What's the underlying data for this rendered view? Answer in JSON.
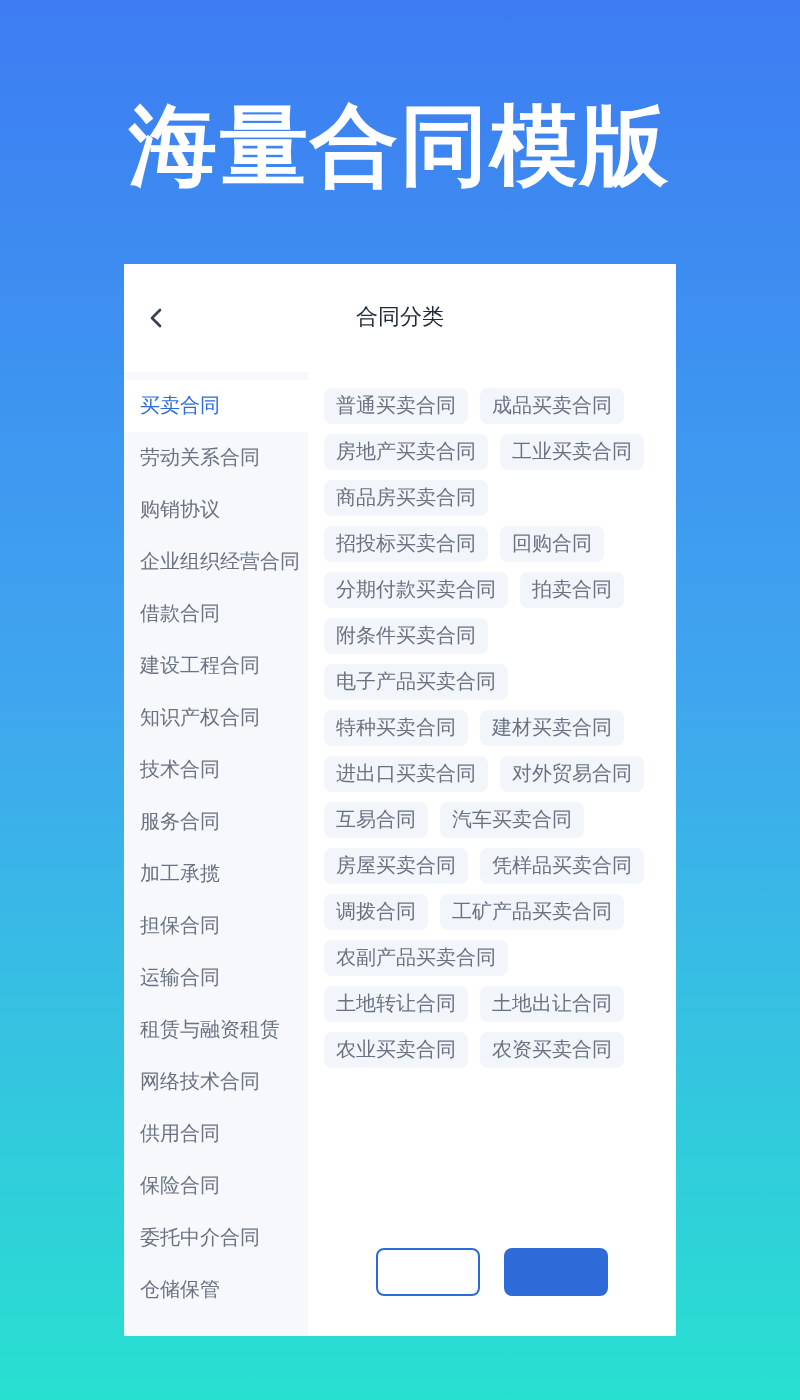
{
  "headline": "海量合同模版",
  "header": {
    "title": "合同分类"
  },
  "sidebar": {
    "items": [
      {
        "label": "买卖合同",
        "selected": true
      },
      {
        "label": "劳动关系合同",
        "selected": false
      },
      {
        "label": "购销协议",
        "selected": false
      },
      {
        "label": "企业组织经营合同",
        "selected": false
      },
      {
        "label": "借款合同",
        "selected": false
      },
      {
        "label": "建设工程合同",
        "selected": false
      },
      {
        "label": "知识产权合同",
        "selected": false
      },
      {
        "label": "技术合同",
        "selected": false
      },
      {
        "label": "服务合同",
        "selected": false
      },
      {
        "label": "加工承揽",
        "selected": false
      },
      {
        "label": "担保合同",
        "selected": false
      },
      {
        "label": "运输合同",
        "selected": false
      },
      {
        "label": "租赁与融资租赁",
        "selected": false
      },
      {
        "label": "网络技术合同",
        "selected": false
      },
      {
        "label": "供用合同",
        "selected": false
      },
      {
        "label": "保险合同",
        "selected": false
      },
      {
        "label": "委托中介合同",
        "selected": false
      },
      {
        "label": "仓储保管",
        "selected": false
      }
    ]
  },
  "tags": [
    "普通买卖合同",
    "成品买卖合同",
    "房地产买卖合同",
    "工业买卖合同",
    "商品房买卖合同",
    "招投标买卖合同",
    "回购合同",
    "分期付款买卖合同",
    "拍卖合同",
    "附条件买卖合同",
    "电子产品买卖合同",
    "特种买卖合同",
    "建材买卖合同",
    "进出口买卖合同",
    "对外贸易合同",
    "互易合同",
    "汽车买卖合同",
    "房屋买卖合同",
    "凭样品买卖合同",
    "调拨合同",
    "工矿产品买卖合同",
    "农副产品买卖合同",
    "土地转让合同",
    "土地出让合同",
    "农业买卖合同",
    "农资买卖合同"
  ],
  "buttons": [
    {
      "kind": "outline"
    },
    {
      "kind": "filled"
    }
  ]
}
